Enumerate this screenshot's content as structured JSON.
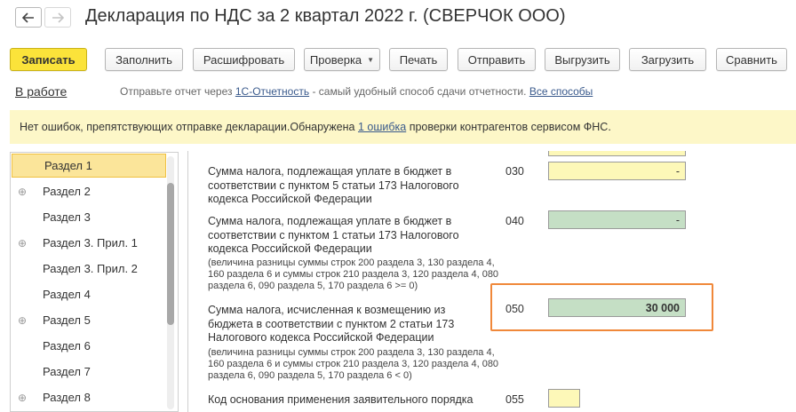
{
  "window": {
    "title": "Декларация по НДС за 2 квартал 2022 г. (СВЕРЧОК ООО)"
  },
  "toolbar": {
    "save_label": "Записать",
    "fill_label": "Заполнить",
    "decode_label": "Расшифровать",
    "check_label": "Проверка",
    "print_label": "Печать",
    "send_label": "Отправить",
    "export_label": "Выгрузить",
    "import_label": "Загрузить",
    "compare_label": "Сравнить"
  },
  "status": {
    "label": "В работе",
    "notice_prefix": "Отправьте отчет через",
    "notice_link": "1С-Отчетность",
    "notice_middle": "- самый удобный способ сдачи отчетности.",
    "notice_all_link": "Все способы"
  },
  "info": {
    "prefix": "Нет ошибок, препятствующих отправке декларации.Обнаружена",
    "link": "1 ошибка",
    "suffix": "проверки контрагентов сервисом ФНС."
  },
  "sidebar": {
    "items": [
      {
        "label": "Раздел 1",
        "expandable": false,
        "active": true
      },
      {
        "label": "Раздел 2",
        "expandable": true,
        "active": false
      },
      {
        "label": "Раздел 3",
        "expandable": false,
        "active": false
      },
      {
        "label": "Раздел 3. Прил. 1",
        "expandable": true,
        "active": false
      },
      {
        "label": "Раздел 3. Прил. 2",
        "expandable": false,
        "active": false
      },
      {
        "label": "Раздел 4",
        "expandable": false,
        "active": false
      },
      {
        "label": "Раздел 5",
        "expandable": true,
        "active": false
      },
      {
        "label": "Раздел 6",
        "expandable": false,
        "active": false
      },
      {
        "label": "Раздел 7",
        "expandable": false,
        "active": false
      },
      {
        "label": "Раздел 8",
        "expandable": true,
        "active": false
      }
    ]
  },
  "form": {
    "row030": {
      "label": "Сумма налога, подлежащая уплате в бюджет в соответствии с пунктом 5 статьи 173 Налогового кодекса Российской Федерации",
      "code": "030",
      "value": "-"
    },
    "row040": {
      "label": "Сумма налога, подлежащая уплате в бюджет в соответствии с пунктом 1 статьи 173 Налогового кодекса Российской Федерации",
      "note": "(величина разницы суммы строк 200 раздела 3, 130 раздела 4, 160 раздела 6 и суммы строк 210 раздела 3, 120 раздела 4, 080 раздела 6, 090 раздела 5, 170 раздела 6 >= 0)",
      "code": "040",
      "value": "-"
    },
    "row050": {
      "label": "Сумма налога, исчисленная к возмещению из бюджета в соответствии с пунктом 2 статьи 173 Налогового кодекса Российской Федерации",
      "note": "(величина разницы суммы строк 200 раздела 3, 130 раздела 4, 160 раздела 6 и суммы строк 210 раздела 3, 120 раздела 4, 080 раздела 6, 090 раздела 5, 170 раздела 6 < 0)",
      "code": "050",
      "value": "30 000"
    },
    "row055": {
      "label": "Код основания применения заявительного порядка",
      "code": "055",
      "value": ""
    }
  },
  "colors": {
    "primary_button": "#fbe33a",
    "info_bar": "#fdf7c8",
    "active_item": "#fbe59a",
    "field_yellow": "#fdf8b8",
    "field_green": "#c5dfc5",
    "highlight_frame": "#f0883a",
    "link": "#3a5a8c"
  },
  "icons": {
    "back": "arrow-left-icon",
    "forward": "arrow-right-icon",
    "expand": "plus-circle-icon",
    "dropdown": "triangle-down-icon"
  }
}
